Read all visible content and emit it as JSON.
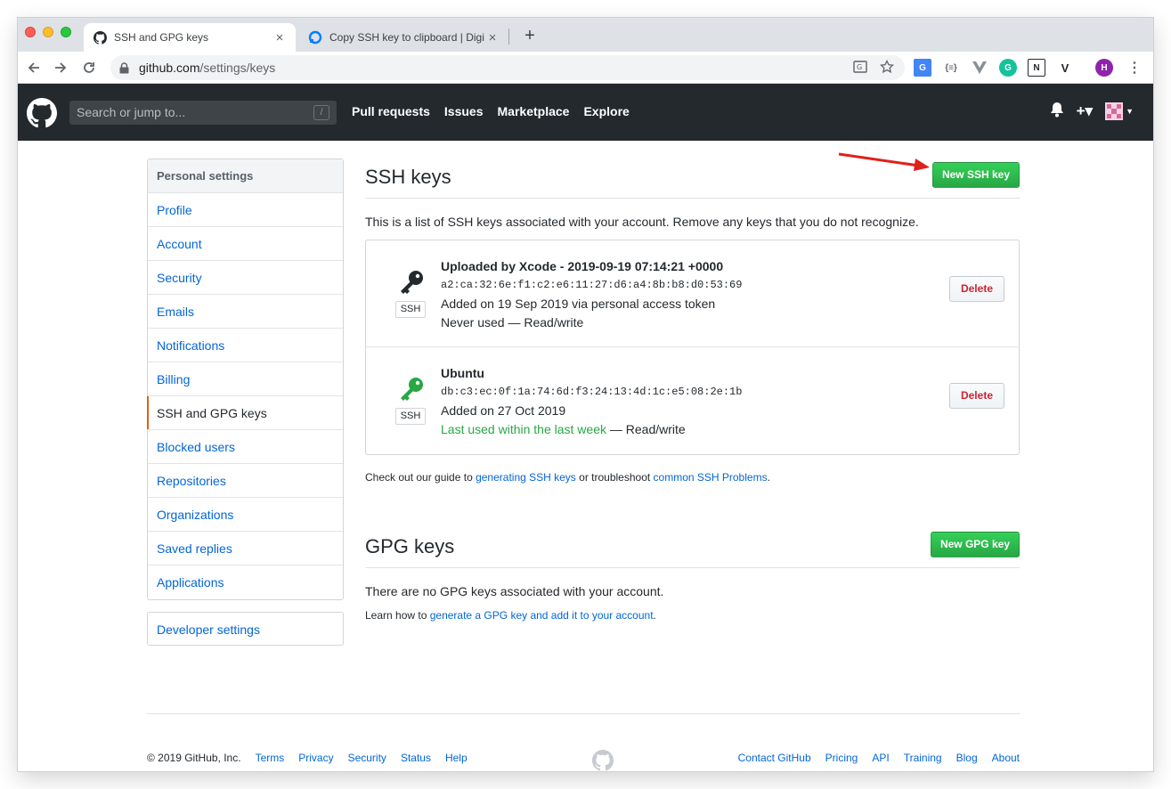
{
  "browser": {
    "tabs": [
      {
        "title": "SSH and GPG keys",
        "close": "×",
        "favicon": "github-icon"
      },
      {
        "title": "Copy SSH key to clipboard | Digi",
        "close": "×",
        "favicon": "digitalocean-icon"
      }
    ],
    "newtab": "+",
    "url_host": "github.com",
    "url_path": "/settings/keys",
    "profile_initial": "H"
  },
  "header": {
    "search_placeholder": "Search or jump to...",
    "slash": "/",
    "nav": [
      "Pull requests",
      "Issues",
      "Marketplace",
      "Explore"
    ],
    "plus": "+▾"
  },
  "sidebar": {
    "heading": "Personal settings",
    "items": [
      "Profile",
      "Account",
      "Security",
      "Emails",
      "Notifications",
      "Billing",
      "SSH and GPG keys",
      "Blocked users",
      "Repositories",
      "Organizations",
      "Saved replies",
      "Applications"
    ],
    "selected": "SSH and GPG keys",
    "developer": "Developer settings"
  },
  "ssh": {
    "title": "SSH keys",
    "new_button": "New SSH key",
    "description": "This is a list of SSH keys associated with your account. Remove any keys that you do not recognize.",
    "keys": [
      {
        "title": "Uploaded by Xcode - 2019-09-19 07:14:21 +0000",
        "fingerprint": "a2:ca:32:6e:f1:c2:e6:11:27:d6:a4:8b:b8:d0:53:69",
        "added": "Added on 19 Sep 2019 via personal access token",
        "usage": "Never used — Read/write",
        "label": "SSH",
        "delete": "Delete",
        "icon_color": "#24292e"
      },
      {
        "title": "Ubuntu",
        "fingerprint": "db:c3:ec:0f:1a:74:6d:f3:24:13:4d:1c:e5:08:2e:1b",
        "added": "Added on 27 Oct 2019",
        "usage_green": "Last used within the last week",
        "usage_rest": " — Read/write",
        "label": "SSH",
        "delete": "Delete",
        "icon_color": "#28a745"
      }
    ],
    "note_prefix": "Check out our guide to ",
    "note_link1": "generating SSH keys",
    "note_mid": " or troubleshoot ",
    "note_link2": "common SSH Problems",
    "note_end": "."
  },
  "gpg": {
    "title": "GPG keys",
    "new_button": "New GPG key",
    "empty": "There are no GPG keys associated with your account.",
    "learn_prefix": "Learn how to ",
    "learn_link": "generate a GPG key and add it to your account",
    "learn_end": "."
  },
  "footer": {
    "copyright": "© 2019 GitHub, Inc.",
    "left_links": [
      "Terms",
      "Privacy",
      "Security",
      "Status",
      "Help"
    ],
    "right_links": [
      "Contact GitHub",
      "Pricing",
      "API",
      "Training",
      "Blog",
      "About"
    ]
  },
  "colors": {
    "accent_green": "#28a745",
    "link": "#0366d6",
    "header_bg": "#24292e",
    "annotation_arrow": "#e0201b"
  }
}
